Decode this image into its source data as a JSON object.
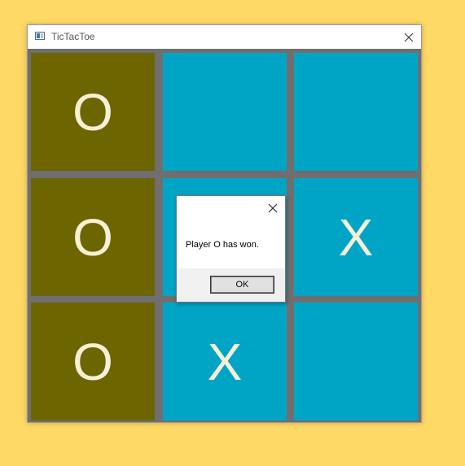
{
  "window": {
    "title": "TicTacToe",
    "app_icon": "window-app-icon",
    "close_icon": "close-icon"
  },
  "board": {
    "cells": [
      [
        "O",
        "",
        ""
      ],
      [
        "O",
        "",
        "X"
      ],
      [
        "O",
        "X",
        ""
      ]
    ],
    "winning_cells": [
      [
        0,
        0
      ],
      [
        1,
        0
      ],
      [
        2,
        0
      ]
    ],
    "colors": {
      "cell": "#00A5C6",
      "winning_cell": "#6D6500",
      "mark": "#F7F0D6",
      "grid": "#6F6F6F"
    }
  },
  "dialog": {
    "message": "Player O has won.",
    "ok_label": "OK",
    "close_icon": "close-icon"
  },
  "background_color": "#FFD966"
}
